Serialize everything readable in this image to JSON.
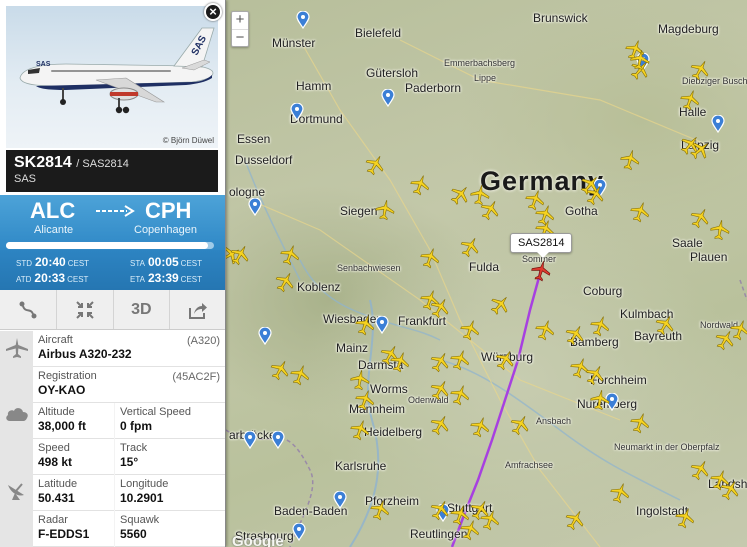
{
  "flight": {
    "number": "SK2814",
    "callsign": "/ SAS2814",
    "airline": "SAS",
    "photo_credit": "© Björn Düwel",
    "origin_code": "ALC",
    "origin_city": "Alicante",
    "dest_code": "CPH",
    "dest_city": "Copenhagen",
    "progress_fraction": 0.97,
    "std_label": "STD",
    "std_time": "20:40",
    "std_tz": "CEST",
    "atd_label": "ATD",
    "atd_time": "20:33",
    "atd_tz": "CEST",
    "sta_label": "STA",
    "sta_time": "00:05",
    "sta_tz": "CEST",
    "eta_label": "ETA",
    "eta_time": "23:39",
    "eta_tz": "CEST"
  },
  "toolbar": {
    "route_icon": "route-icon",
    "fit_icon": "compress-icon",
    "view3d_label": "3D",
    "share_icon": "share-icon"
  },
  "details": {
    "aircraft_label": "Aircraft",
    "aircraft_type_code": "(A320)",
    "aircraft_value": "Airbus A320-232",
    "registration_label": "Registration",
    "registration_hex": "(45AC2F)",
    "registration_value": "OY-KAO",
    "altitude_label": "Altitude",
    "altitude_value": "38,000 ft",
    "vspeed_label": "Vertical Speed",
    "vspeed_value": "0 fpm",
    "speed_label": "Speed",
    "speed_value": "498 kt",
    "track_label": "Track",
    "track_value": "15°",
    "lat_label": "Latitude",
    "lat_value": "50.431",
    "lon_label": "Longitude",
    "lon_value": "10.2901",
    "radar_label": "Radar",
    "radar_value": "F-EDDS1",
    "squawk_label": "Squawk",
    "squawk_value": "5560"
  },
  "map": {
    "country_label": "Germany",
    "selected_callout": "SAS2814",
    "zoom_in": "+",
    "zoom_out": "−",
    "attribution": "Google",
    "cities": {
      "munster": "Münster",
      "bielefeld": "Bielefeld",
      "brunswick": "Brunswick",
      "magdeburg": "Magdeburg",
      "gutersloh": "Gütersloh",
      "hamm": "Hamm",
      "paderborn": "Paderborn",
      "dortmund": "Dortmund",
      "halle": "Halle",
      "essen": "Essen",
      "leipzig": "Leipzig",
      "dusseldorf": "Dusseldorf",
      "cologne": "ologne",
      "siegen": "Siegen",
      "gotha": "Gotha",
      "saale": "Saale",
      "fulda": "Fulda",
      "plauen": "Plauen",
      "koblenz": "Koblenz",
      "coburg": "Coburg",
      "wiesbaden": "Wiesbaden",
      "frankfurt": "Frankfurt",
      "mainz": "Mainz",
      "kulmbach": "Kulmbach",
      "bayreuth": "Bayreuth",
      "bamberg": "Bamberg",
      "darmstadt": "Darmsta",
      "wurzburg": "Würzburg",
      "worms": "Worms",
      "forchheim": "Forchheim",
      "mannheim": "Mannheim",
      "nuremberg": "Nuremberg",
      "saarbrucken": "arbrücken",
      "heidelberg": "Heidelberg",
      "karlsruhe": "Karlsruhe",
      "neumarkt": "Neumarkt in der Oberpfalz",
      "baden": "Baden-Baden",
      "pforzheim": "Pforzheim",
      "stuttgart": "Stuttgart",
      "ingolstadt": "Ingolstadt",
      "strasbourg": "Strasbourg",
      "reutlingen": "Reutlingen",
      "landshut": "Landshut"
    },
    "small_labels": {
      "emmerbach": "Emmerbachsberg",
      "lippe": "Lippe",
      "sommer": "Sommer",
      "ansbach": "Ansbach",
      "amfrach": "Amfrachsee",
      "diebzig": "Diebziger Busch",
      "odenwald": "Odenwald",
      "nordwald": "Nordwald",
      "bachwiesen": "Senbachwiesen"
    }
  }
}
